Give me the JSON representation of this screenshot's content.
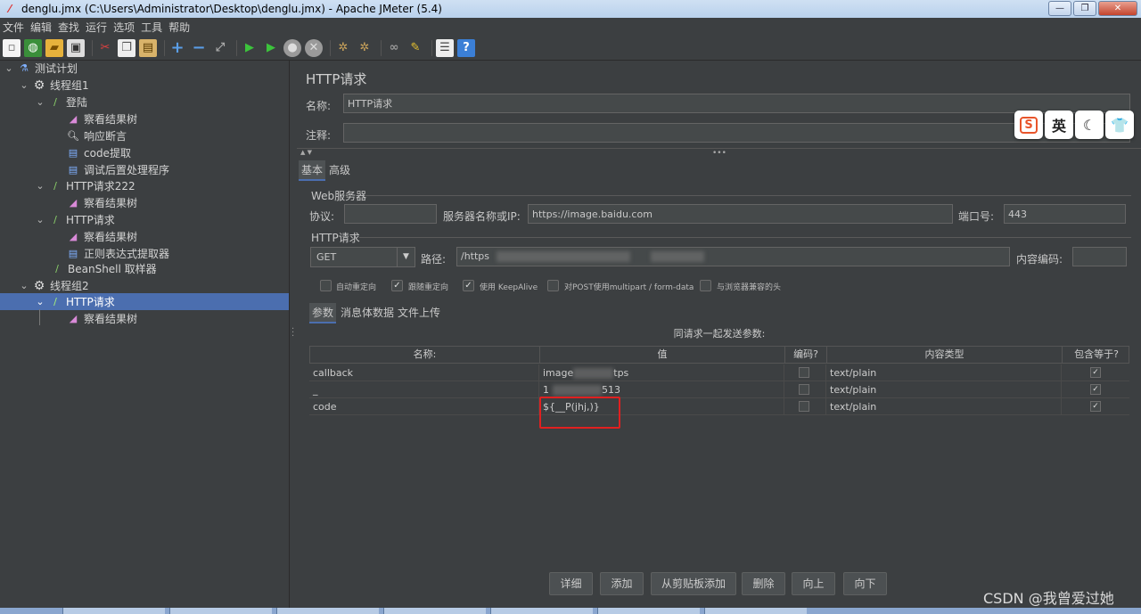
{
  "window": {
    "title": "denglu.jmx (C:\\Users\\Administrator\\Desktop\\denglu.jmx) - Apache JMeter (5.4)",
    "buttons": [
      "—",
      "❐",
      "✕"
    ]
  },
  "menu": [
    "文件",
    "编辑",
    "查找",
    "运行",
    "选项",
    "工具",
    "帮助"
  ],
  "toolbar": {
    "icons": [
      "new-icon",
      "templates-icon",
      "open-icon",
      "save-icon",
      "cut-icon",
      "copy-icon",
      "paste-icon",
      "expand-icon",
      "collapse-icon",
      "toggle-icon",
      "start-icon",
      "start-no-pause-icon",
      "stop-icon",
      "shutdown-icon",
      "clear-icon",
      "clear-all-icon",
      "search-icon",
      "reset-search-icon",
      "function-helper-icon",
      "help-icon"
    ]
  },
  "tree": {
    "items": [
      {
        "label": "测试计划",
        "icon": "flask-icon"
      },
      {
        "label": "线程组1",
        "icon": "gear-icon"
      },
      {
        "label": "登陆",
        "icon": "pipette-icon"
      },
      {
        "label": "察看结果树",
        "icon": "chart-icon"
      },
      {
        "label": "响应断言",
        "icon": "magnifier-icon"
      },
      {
        "label": "code提取",
        "icon": "doc-icon"
      },
      {
        "label": "调试后置处理程序",
        "icon": "doc-icon"
      },
      {
        "label": "HTTP请求222",
        "icon": "pipette-icon"
      },
      {
        "label": "察看结果树",
        "icon": "chart-icon"
      },
      {
        "label": "HTTP请求",
        "icon": "pipette-icon"
      },
      {
        "label": "察看结果树",
        "icon": "chart-icon"
      },
      {
        "label": "正则表达式提取器",
        "icon": "doc-icon"
      },
      {
        "label": "BeanShell 取样器",
        "icon": "pipette-icon"
      },
      {
        "label": "线程组2",
        "icon": "gear-icon"
      },
      {
        "label": "HTTP请求",
        "icon": "pipette-icon"
      },
      {
        "label": "察看结果树",
        "icon": "chart-icon"
      }
    ]
  },
  "panel": {
    "title": "HTTP请求",
    "name_label": "名称:",
    "name_value": "HTTP请求",
    "comment_label": "注释:",
    "comment_value": "",
    "tabs": [
      "基本",
      "高级"
    ],
    "web_server": {
      "section": "Web服务器",
      "protocol_label": "协议:",
      "protocol_value": "",
      "server_label": "服务器名称或IP:",
      "server_value": "https://image.baidu.com",
      "port_label": "端口号:",
      "port_value": "443"
    },
    "http_request": {
      "section": "HTTP请求",
      "method": "GET",
      "path_label": "路径:",
      "path_value": "/https",
      "encoding_label": "内容编码:",
      "encoding_value": ""
    },
    "options": [
      {
        "label": "自动重定向",
        "checked": false
      },
      {
        "label": "跟随重定向",
        "checked": true
      },
      {
        "label": "使用 KeepAlive",
        "checked": true
      },
      {
        "label": "对POST使用multipart / form-data",
        "checked": false
      },
      {
        "label": "与浏览器兼容的头",
        "checked": false
      }
    ],
    "sub_tabs": [
      "参数",
      "消息体数据",
      "文件上传"
    ],
    "table": {
      "caption": "同请求一起发送参数:",
      "headers": [
        "名称:",
        "值",
        "编码?",
        "内容类型",
        "包含等于?"
      ],
      "rows": [
        {
          "name": "callback",
          "value": "image",
          "value_tail": "tps",
          "encode": false,
          "content_type": "text/plain",
          "include_equals": true
        },
        {
          "name": "_",
          "value": "1",
          "value_tail": "513",
          "encode": false,
          "content_type": "text/plain",
          "include_equals": true
        },
        {
          "name": "code",
          "value": "${__P(jhj,)}",
          "value_tail": "",
          "encode": false,
          "content_type": "text/plain",
          "include_equals": true
        }
      ]
    },
    "buttons": [
      "详细",
      "添加",
      "从剪贴板添加",
      "删除",
      "向上",
      "向下"
    ]
  },
  "floating_toolbar": [
    "S",
    "英",
    "☾",
    "👕"
  ],
  "watermark": "CSDN @我曾爱过她"
}
